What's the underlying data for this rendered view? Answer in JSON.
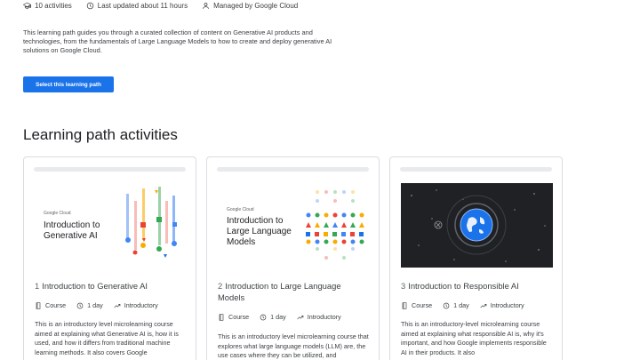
{
  "meta": {
    "activities": "10 activities",
    "updated": "Last updated about 11 hours",
    "managed": "Managed by Google Cloud"
  },
  "description": "This learning path guides you through a curated collection of content on Generative AI products and technologies, from the fundamentals of Large Language Models to how to create and deploy generative AI solutions on Google Cloud.",
  "select_button": "Select this learning path",
  "section_title": "Learning path activities",
  "cards": [
    {
      "number": "1",
      "title": "Introduction to Generative AI",
      "thumb_logo": "Google Cloud",
      "thumb_title": "Introduction to Generative AI",
      "type": "Course",
      "duration": "1 day",
      "level": "Introductory",
      "description": "This is an introductory level microlearning course aimed at explaining what Generative AI is, how it is used, and how it differs from traditional machine learning methods. It also covers Google"
    },
    {
      "number": "2",
      "title": "Introduction to Large Language Models",
      "thumb_logo": "Google Cloud",
      "thumb_title": "Introduction to Large Language Models",
      "type": "Course",
      "duration": "1 day",
      "level": "Introductory",
      "description": "This is an introductory level microlearning course that explores what large language models (LLM) are, the use cases where they can be utilized, and"
    },
    {
      "number": "3",
      "title": "Introduction to Responsible AI",
      "type": "Course",
      "duration": "1 day",
      "level": "Introductory",
      "description": "This is an introductory-level microlearning course aimed at explaining what responsible AI is, why it's important, and how Google implements responsible AI in their products. It also"
    }
  ],
  "colors": {
    "accent": "#1a73e8",
    "thumb_dark": "#202124"
  }
}
